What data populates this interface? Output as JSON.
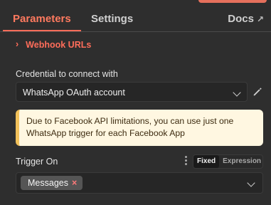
{
  "tabs": {
    "parameters": "Parameters",
    "settings": "Settings",
    "docs": "Docs",
    "docs_icon": "↗"
  },
  "webhook": {
    "chevron": "›",
    "label": "Webhook URLs"
  },
  "credential": {
    "label": "Credential to connect with",
    "value": "WhatsApp OAuth account"
  },
  "notice": {
    "text": "Due to Facebook API limitations, you can use just one WhatsApp trigger for each Facebook App"
  },
  "trigger": {
    "label": "Trigger On",
    "mode_fixed": "Fixed",
    "mode_expression": "Expression",
    "chip_label": "Messages",
    "chip_remove": "×"
  },
  "colors": {
    "accent": "#ff6d5a",
    "panel_bg": "#2e2e2e",
    "input_bg": "#262626",
    "notice_bg": "#fff7e1",
    "notice_border": "#f2c15a"
  }
}
